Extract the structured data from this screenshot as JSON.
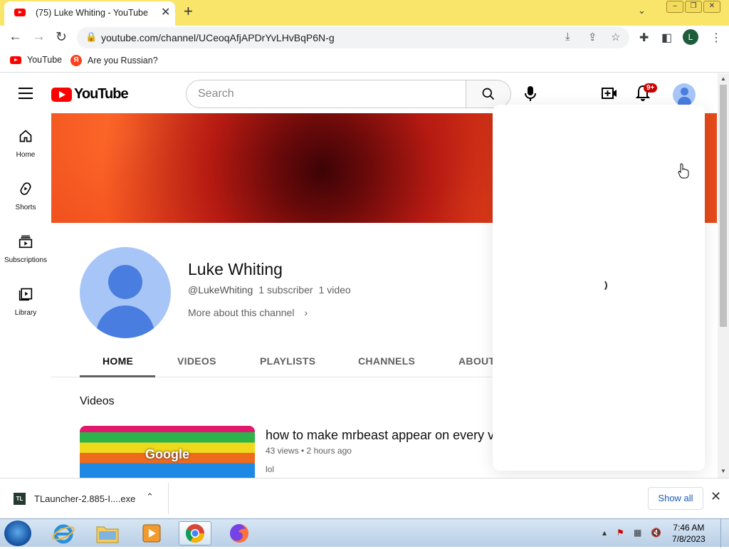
{
  "browser": {
    "tab_title": "(75) Luke Whiting - YouTube",
    "url": "youtube.com/channel/UCeoqAfjAPDrYvLHvBqP6N-g",
    "profile_initial": "L",
    "bookmarks": [
      {
        "label": "YouTube",
        "icon": "youtube-icon"
      },
      {
        "label": "Are you Russian?",
        "icon": "yandex-icon"
      }
    ]
  },
  "youtube": {
    "logo_text": "YouTube",
    "search_placeholder": "Search",
    "notification_badge": "9+",
    "sidebar": [
      {
        "label": "Home",
        "icon": "home-icon"
      },
      {
        "label": "Shorts",
        "icon": "shorts-icon"
      },
      {
        "label": "Subscriptions",
        "icon": "subscriptions-icon"
      },
      {
        "label": "Library",
        "icon": "library-icon"
      }
    ],
    "channel": {
      "name": "Luke Whiting",
      "handle": "@LukeWhiting",
      "subscribers": "1 subscriber",
      "videos": "1 video",
      "more_about": "More about this channel"
    },
    "tabs": [
      "HOME",
      "VIDEOS",
      "PLAYLISTS",
      "CHANNELS",
      "ABOUT"
    ],
    "active_tab": "HOME",
    "section_title": "Videos",
    "video": {
      "title": "how to make mrbeast appear on every v",
      "meta": "43 views • 2 hours ago",
      "description": "lol",
      "thumbnail_text": "Google"
    }
  },
  "downloads": {
    "file_name": "TLauncher-2.885-I....exe",
    "icon_text": "TL",
    "show_all": "Show all"
  },
  "taskbar": {
    "time": "7:46 AM",
    "date": "7/8/2023"
  }
}
